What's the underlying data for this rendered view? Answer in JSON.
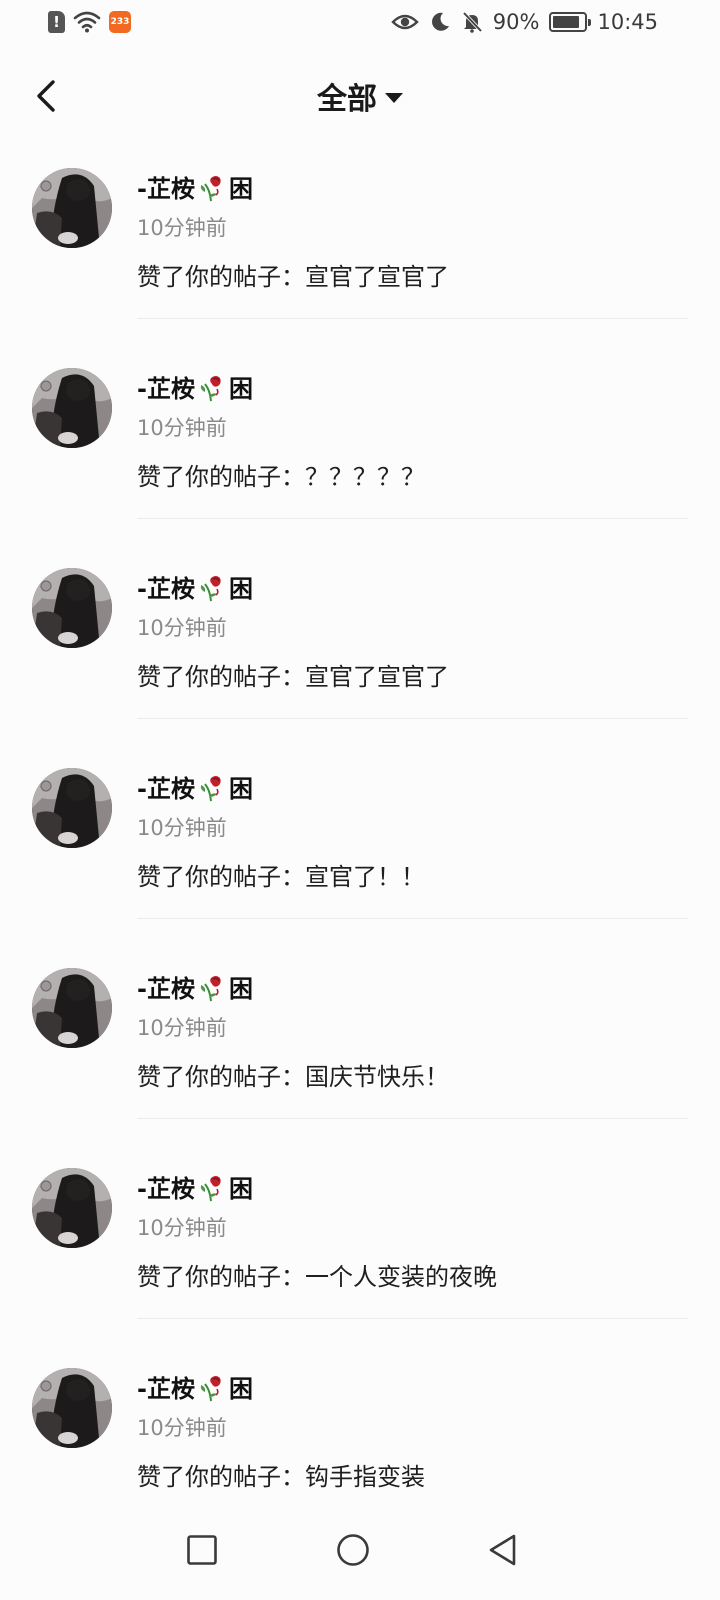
{
  "status_bar": {
    "badge": "233",
    "battery": "90%",
    "time": "10:45"
  },
  "header": {
    "title": "全部"
  },
  "notifications": [
    {
      "user": "-芷桉",
      "user_suffix": "困",
      "time": "10分钟前",
      "message": "赞了你的帖子：宣官了宣官了"
    },
    {
      "user": "-芷桉",
      "user_suffix": "困",
      "time": "10分钟前",
      "message": "赞了你的帖子：？？？？？"
    },
    {
      "user": "-芷桉",
      "user_suffix": "困",
      "time": "10分钟前",
      "message": "赞了你的帖子：宣官了宣官了"
    },
    {
      "user": "-芷桉",
      "user_suffix": "困",
      "time": "10分钟前",
      "message": "赞了你的帖子：宣官了！！"
    },
    {
      "user": "-芷桉",
      "user_suffix": "困",
      "time": "10分钟前",
      "message": "赞了你的帖子：国庆节快乐！"
    },
    {
      "user": "-芷桉",
      "user_suffix": "困",
      "time": "10分钟前",
      "message": "赞了你的帖子：一个人变装的夜晚"
    },
    {
      "user": "-芷桉",
      "user_suffix": "困",
      "time": "10分钟前",
      "message": "赞了你的帖子：钩手指变装"
    }
  ],
  "icons": {
    "back": "back-arrow-icon",
    "dropdown": "caret-down-icon",
    "name_emoji": "wilted-rose-icon",
    "nav_recents": "square-icon",
    "nav_home": "circle-icon",
    "nav_back": "triangle-back-icon"
  },
  "colors": {
    "badge": "#f26a21",
    "rose": "#c0202a",
    "timestamp": "#8a8a8a"
  }
}
